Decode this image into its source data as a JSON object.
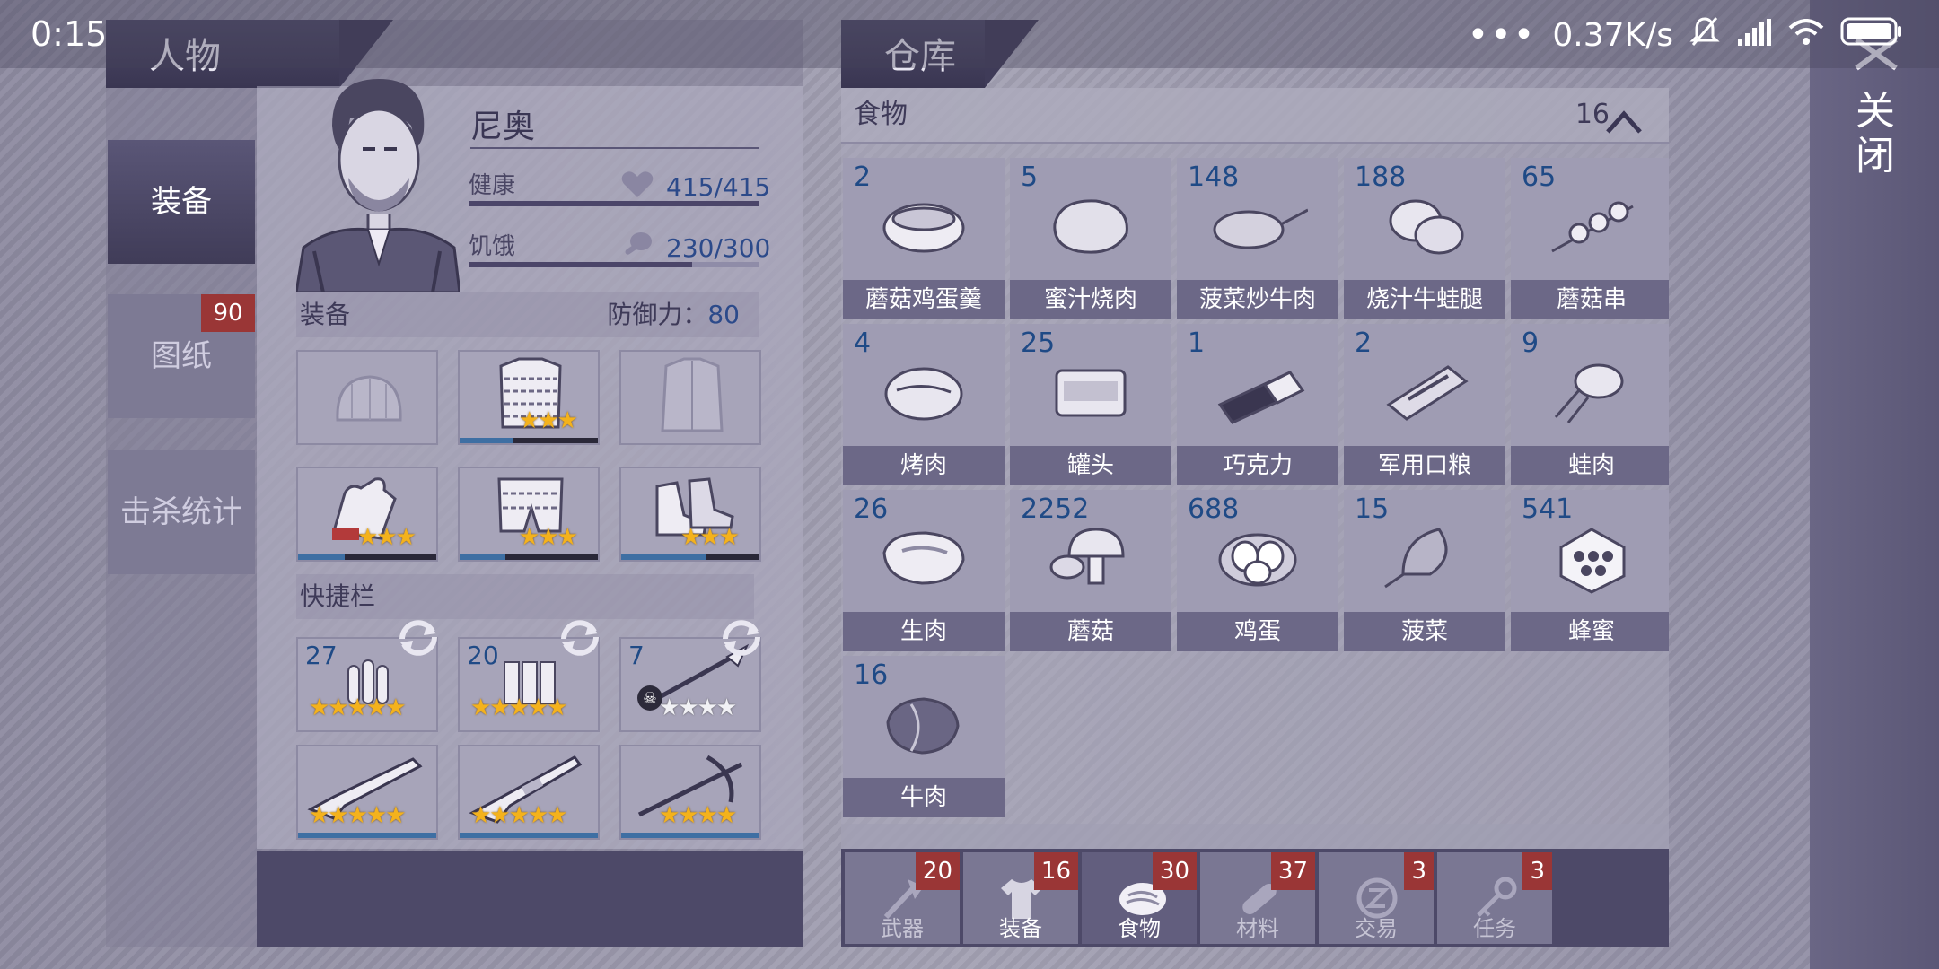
{
  "status_bar": {
    "time": "0:15",
    "dots": "•••",
    "speed": "0.37K/s"
  },
  "left_panel": {
    "tab_title": "人物",
    "side_tabs": [
      {
        "label": "装备"
      },
      {
        "label": "图纸",
        "badge": "90"
      },
      {
        "label": "击杀统计"
      }
    ],
    "character": {
      "name": "尼奥",
      "health_label": "健康",
      "health_value": "415/415",
      "health_fraction": 1.0,
      "hunger_label": "饥饿",
      "hunger_value": "230/300",
      "hunger_fraction": 0.767
    },
    "equipment": {
      "header": "装备",
      "defense_label": "防御力：",
      "defense_value": "80",
      "slots": [
        {
          "name": "hat",
          "stars": 0,
          "durability": 0
        },
        {
          "name": "armor",
          "stars": 3,
          "durability": 0.38
        },
        {
          "name": "jacket",
          "stars": 0,
          "durability": 0
        },
        {
          "name": "gloves",
          "stars": 3,
          "durability": 0.34
        },
        {
          "name": "pants",
          "stars": 3,
          "durability": 0.33
        },
        {
          "name": "boots",
          "stars": 3,
          "durability": 0.62
        }
      ]
    },
    "quickbar": {
      "header": "快捷栏",
      "items": [
        {
          "name": "bullets-small",
          "count": "27",
          "stars": 5
        },
        {
          "name": "shells",
          "count": "20",
          "stars": 5
        },
        {
          "name": "spear",
          "count": "7",
          "stars": 4
        },
        {
          "name": "rifle",
          "count": "",
          "stars": 5
        },
        {
          "name": "shotgun",
          "count": "",
          "stars": 5
        },
        {
          "name": "crossbow",
          "count": "",
          "stars": 4
        }
      ]
    }
  },
  "warehouse": {
    "tab_title": "仓库",
    "category": "食物",
    "category_count": "16",
    "items": [
      {
        "qty": "2",
        "name": "蘑菇鸡蛋羹"
      },
      {
        "qty": "5",
        "name": "蜜汁烧肉"
      },
      {
        "qty": "148",
        "name": "菠菜炒牛肉"
      },
      {
        "qty": "188",
        "name": "烧汁牛蛙腿"
      },
      {
        "qty": "65",
        "name": "蘑菇串"
      },
      {
        "qty": "4",
        "name": "烤肉"
      },
      {
        "qty": "25",
        "name": "罐头"
      },
      {
        "qty": "1",
        "name": "巧克力"
      },
      {
        "qty": "2",
        "name": "军用口粮"
      },
      {
        "qty": "9",
        "name": "蛙肉"
      },
      {
        "qty": "26",
        "name": "生肉"
      },
      {
        "qty": "2252",
        "name": "蘑菇"
      },
      {
        "qty": "688",
        "name": "鸡蛋"
      },
      {
        "qty": "15",
        "name": "菠菜"
      },
      {
        "qty": "541",
        "name": "蜂蜜"
      },
      {
        "qty": "16",
        "name": "牛肉"
      }
    ],
    "bottom_tabs": [
      {
        "label": "武器",
        "badge": "20"
      },
      {
        "label": "装备",
        "badge": "16"
      },
      {
        "label": "食物",
        "badge": "30"
      },
      {
        "label": "材料",
        "badge": "37"
      },
      {
        "label": "交易",
        "badge": "3"
      },
      {
        "label": "任务",
        "badge": "3"
      }
    ]
  },
  "close_label": "关闭",
  "colors": {
    "accent_blue": "#1f4a86",
    "badge_red": "#9a3636",
    "star_gold": "#f4b21c"
  }
}
